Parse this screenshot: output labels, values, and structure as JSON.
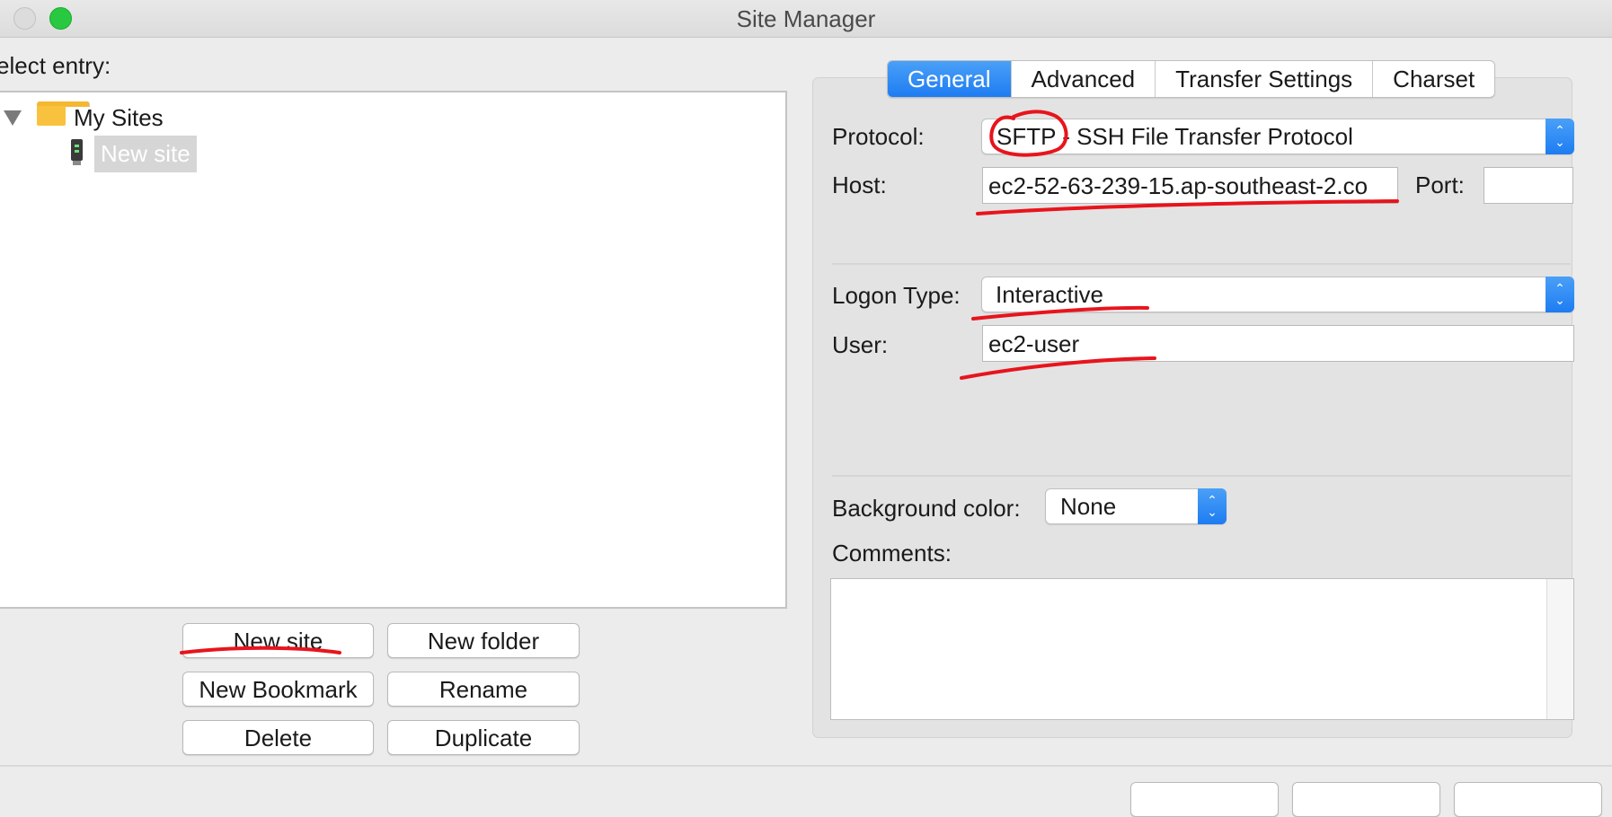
{
  "window": {
    "title": "Site Manager"
  },
  "left": {
    "select_entry_label": "elect entry:",
    "tree": {
      "root_label": "My Sites",
      "selected_item_label": "New site"
    },
    "buttons": {
      "new_site": "New site",
      "new_folder": "New folder",
      "new_bookmark": "New Bookmark",
      "rename": "Rename",
      "delete": "Delete",
      "duplicate": "Duplicate"
    }
  },
  "right": {
    "tabs": [
      "General",
      "Advanced",
      "Transfer Settings",
      "Charset"
    ],
    "active_tab": "General",
    "protocol": {
      "label": "Protocol:",
      "value": "SFTP - SSH File Transfer Protocol"
    },
    "host": {
      "label": "Host:",
      "value": "ec2-52-63-239-15.ap-southeast-2.co"
    },
    "port": {
      "label": "Port:",
      "value": ""
    },
    "logon_type": {
      "label": "Logon Type:",
      "value": "Interactive"
    },
    "user": {
      "label": "User:",
      "value": "ec2-user"
    },
    "background_color": {
      "label": "Background color:",
      "value": "None"
    },
    "comments": {
      "label": "Comments:",
      "value": ""
    }
  },
  "colors": {
    "accent_blue": "#1e7cf2",
    "annotation_red": "#e8141c",
    "close_button_green": "#28c940"
  }
}
